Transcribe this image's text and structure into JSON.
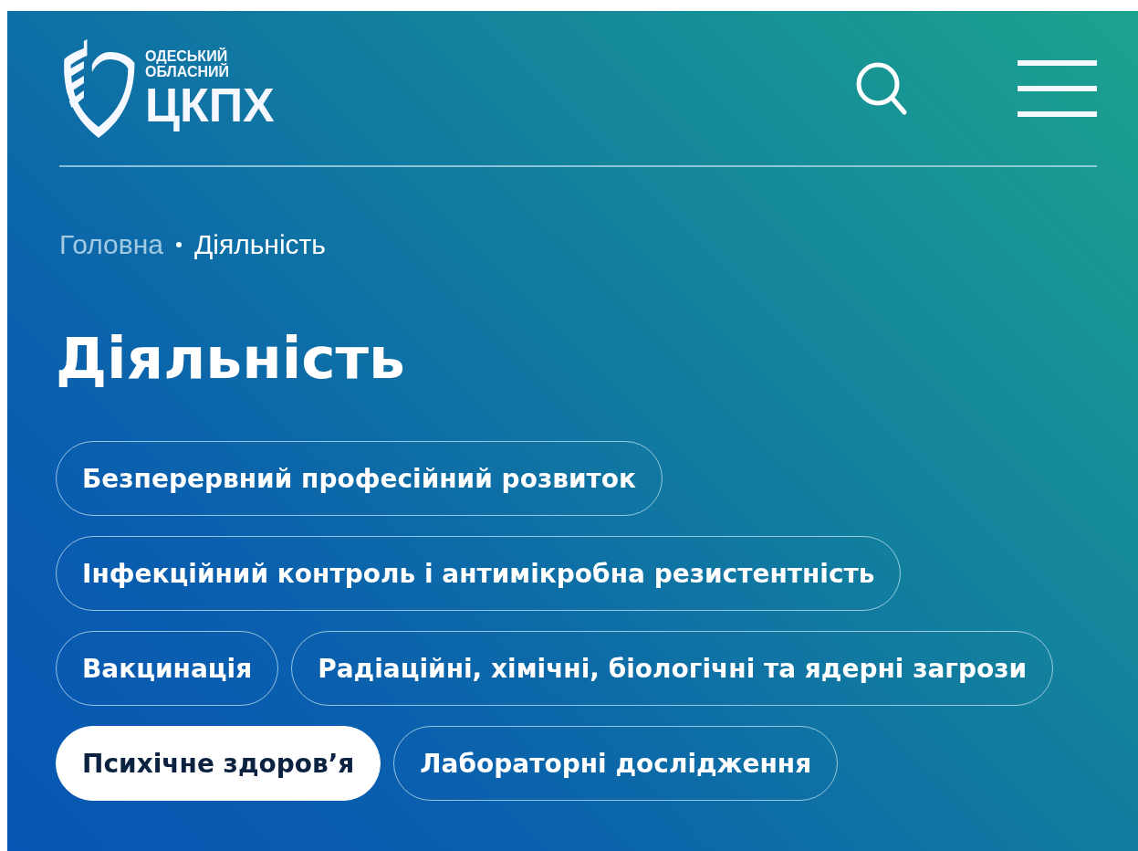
{
  "logo": {
    "line_1": "ОДЕСЬКИЙ",
    "line_2": "ОБЛАСНИЙ",
    "name": "ЦКПХ"
  },
  "breadcrumbs": [
    {
      "label": "Головна",
      "current": false
    },
    {
      "label": "Діяльність",
      "current": true
    }
  ],
  "title": "Діяльність",
  "categories": [
    {
      "label": "Безперервний професійний розвиток",
      "selected": false
    },
    {
      "label": "Інфекційний контроль і антимікробна резистентність",
      "selected": false
    },
    {
      "label": "Вакцинація",
      "selected": false
    },
    {
      "label": "Радіаційні, хімічні, біологічні та ядерні загрози",
      "selected": false
    },
    {
      "label": "Психічне здоров’я",
      "selected": true
    },
    {
      "label": "Лабораторні дослідження",
      "selected": false
    }
  ]
}
